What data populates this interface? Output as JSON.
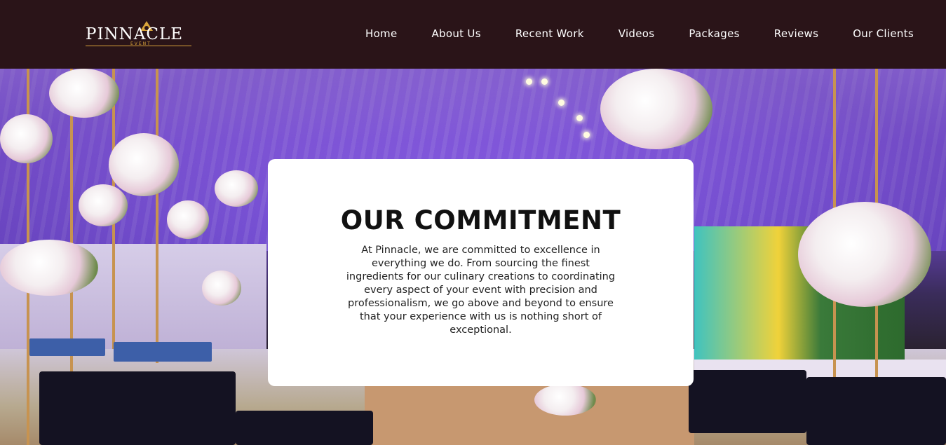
{
  "header": {
    "logo_text": "PINNACLE",
    "logo_subtext": "EVENT",
    "nav": [
      {
        "label": "Home"
      },
      {
        "label": "About Us"
      },
      {
        "label": "Recent Work"
      },
      {
        "label": "Videos"
      },
      {
        "label": "Packages"
      },
      {
        "label": "Reviews"
      },
      {
        "label": "Our Clients"
      }
    ]
  },
  "commitment": {
    "title": "OUR COMMITMENT",
    "body": "At Pinnacle, we are committed to excellence in everything we do. From sourcing the finest ingredients for our culinary creations to coordinating every aspect of your event with precision and professionalism, we go above and beyond to ensure that your experience with us is nothing short of exceptional."
  },
  "colors": {
    "header_bg": "#2a1418",
    "logo_gold": "#d9a43a",
    "card_bg": "#ffffff",
    "hero_purple": "#8f63ef"
  }
}
